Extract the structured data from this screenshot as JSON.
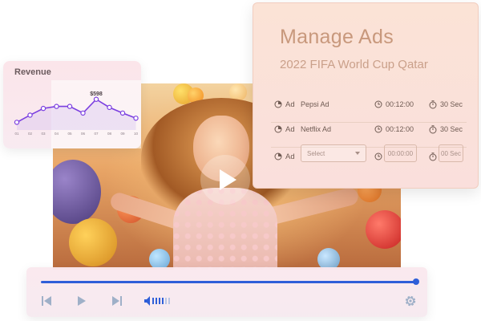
{
  "revenue": {
    "title": "Revenue",
    "highlight_label": "$598",
    "x_labels": [
      "01",
      "02",
      "03",
      "04",
      "05",
      "06",
      "07",
      "08",
      "09",
      "10"
    ],
    "values": [
      150,
      290,
      420,
      460,
      460,
      330,
      598,
      440,
      330,
      230
    ],
    "line_color": "#7b3fe0"
  },
  "video": {
    "play_icon": "play-icon"
  },
  "ads": {
    "title": "Manage Ads",
    "subtitle": "2022 FIFA World Cup Qatar",
    "rows": [
      {
        "ad_label": "Ad",
        "name": "Pepsi Ad",
        "time": "00:12:00",
        "duration": "30 Sec"
      },
      {
        "ad_label": "Ad",
        "name": "Netflix Ad",
        "time": "00:12:00",
        "duration": "30 Sec"
      }
    ],
    "new_row": {
      "ad_label": "Ad",
      "select_placeholder": "Select",
      "time_placeholder": "00:00:00",
      "duration_placeholder": "00 Sec"
    }
  },
  "player": {
    "progress": 1.0,
    "accent": "#2f5fd8",
    "icons": [
      "skip-back-icon",
      "play-icon",
      "skip-forward-icon",
      "volume-icon",
      "settings-icon"
    ]
  }
}
